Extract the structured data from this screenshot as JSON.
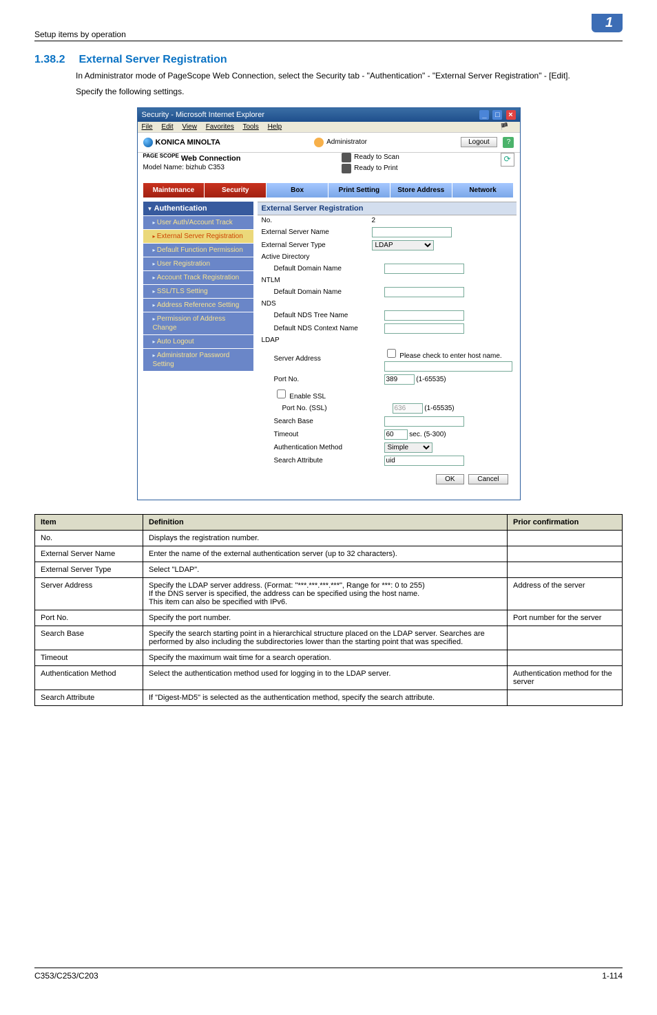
{
  "header": {
    "breadcrumb": "Setup items by operation",
    "badge": "1"
  },
  "section": {
    "number": "1.38.2",
    "title": "External Server Registration",
    "para1": "In Administrator mode of PageScope Web Connection, select the Security tab - \"Authentication\" - \"External Server Registration\" - [Edit].",
    "para2": "Specify the following settings."
  },
  "browser": {
    "title": "Security - Microsoft Internet Explorer",
    "menu": {
      "file": "File",
      "edit": "Edit",
      "view": "View",
      "favorites": "Favorites",
      "tools": "Tools",
      "help": "Help"
    },
    "brand": "KONICA MINOLTA",
    "admin": "Administrator",
    "logout": "Logout",
    "webConnPre": "PAGE SCOPE",
    "webConn": "Web Connection",
    "model": "Model Name: bizhub C353",
    "status1": "Ready to Scan",
    "status2": "Ready to Print",
    "tabs": {
      "maintenance": "Maintenance",
      "security": "Security",
      "box": "Box",
      "print": "Print Setting",
      "store": "Store Address",
      "network": "Network"
    },
    "sidebar": {
      "head": "Authentication",
      "items": [
        "User Auth/Account Track",
        "External Server Registration",
        "Default Function Permission",
        "User Registration",
        "Account Track Registration",
        "SSL/TLS Setting",
        "Address Reference Setting",
        "Permission of Address Change",
        "Auto Logout",
        "Administrator Password Setting"
      ]
    },
    "form": {
      "title": "External Server Registration",
      "rows": {
        "no_lbl": "No.",
        "no_val": "2",
        "esn_lbl": "External Server Name",
        "esn_val": "",
        "est_lbl": "External Server Type",
        "est_val": "LDAP",
        "ad_grp": "Active Directory",
        "ad_ddn": "Default Domain Name",
        "ad_ddn_v": "",
        "ntlm_grp": "NTLM",
        "ntlm_ddn": "Default Domain Name",
        "ntlm_ddn_v": "",
        "nds_grp": "NDS",
        "nds_tree": "Default NDS Tree Name",
        "nds_tree_v": "",
        "nds_ctx": "Default NDS Context Name",
        "nds_ctx_v": "",
        "ldap_grp": "LDAP",
        "sa_lbl": "Server Address",
        "sa_chk": "Please check to enter host name.",
        "sa_val": "",
        "port_lbl": "Port No.",
        "port_val": "389",
        "port_rng": "(1-65535)",
        "ssl_chk": "Enable SSL",
        "sslport_lbl": "Port No. (SSL)",
        "sslport_val": "636",
        "sslport_rng": "(1-65535)",
        "sb_lbl": "Search Base",
        "sb_val": "",
        "to_lbl": "Timeout",
        "to_val": "60",
        "to_rng": "sec. (5-300)",
        "auth_lbl": "Authentication Method",
        "auth_val": "Simple",
        "sattr_lbl": "Search Attribute",
        "sattr_val": "uid",
        "ok": "OK",
        "cancel": "Cancel"
      }
    }
  },
  "table": {
    "h_item": "Item",
    "h_def": "Definition",
    "h_prior": "Prior confirmation",
    "rows": [
      {
        "item": "No.",
        "def": "Displays the registration number.",
        "prior": ""
      },
      {
        "item": "External Server Name",
        "def": "Enter the name of the external authentication server (up to 32 characters).",
        "prior": ""
      },
      {
        "item": "External Server Type",
        "def": "Select \"LDAP\".",
        "prior": ""
      },
      {
        "item": "Server Address",
        "def": "Specify the LDAP server address. (Format: \"***.***.***.***\", Range for ***: 0 to 255)\nIf the DNS server is specified, the address can be specified using the host name.\nThis item can also be specified with IPv6.",
        "prior": "Address of the server"
      },
      {
        "item": "Port No.",
        "def": "Specify the port number.",
        "prior": "Port number for the server"
      },
      {
        "item": "Search Base",
        "def": "Specify the search starting point in a hierarchical structure placed on the LDAP server. Searches are performed by also including the subdirectories lower than the starting point that was specified.",
        "prior": ""
      },
      {
        "item": "Timeout",
        "def": "Specify the maximum wait time for a search operation.",
        "prior": ""
      },
      {
        "item": "Authentication Method",
        "def": "Select the authentication method used for logging in to the LDAP server.",
        "prior": "Authentication method for the server"
      },
      {
        "item": "Search Attribute",
        "def": "If \"Digest-MD5\" is selected as the authentication method, specify the search attribute.",
        "prior": ""
      }
    ]
  },
  "footer": {
    "left": "C353/C253/C203",
    "right": "1-114"
  }
}
